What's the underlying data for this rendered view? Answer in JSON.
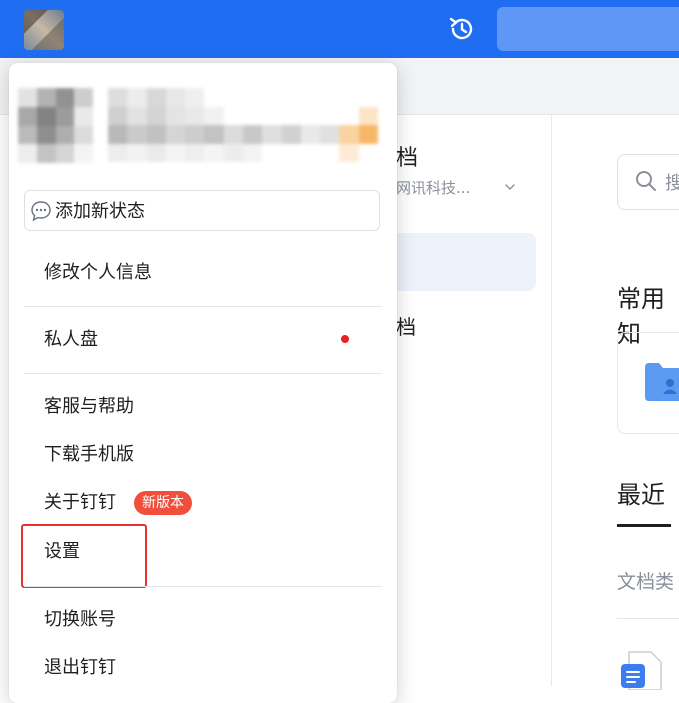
{
  "background": {
    "doc_title_fragment": "档",
    "org_fragment": "网讯科技...",
    "doc_item_fragment": "档",
    "search_fragment": "搜",
    "common_fragment": "常用知",
    "recent_label": "最近",
    "doctype_fragment": "文档类"
  },
  "status": {
    "label": "添加新状态"
  },
  "menu": {
    "edit_profile": "修改个人信息",
    "private_disk": "私人盘",
    "support": "客服与帮助",
    "download_mobile": "下载手机版",
    "about": "关于钉钉",
    "new_version_badge": "新版本",
    "settings": "设置",
    "switch_account": "切换账号",
    "quit": "退出钉钉"
  },
  "colors": {
    "topbar": "#1f6ef2",
    "accent_red": "#e53232",
    "badge": "#f04f3e"
  }
}
